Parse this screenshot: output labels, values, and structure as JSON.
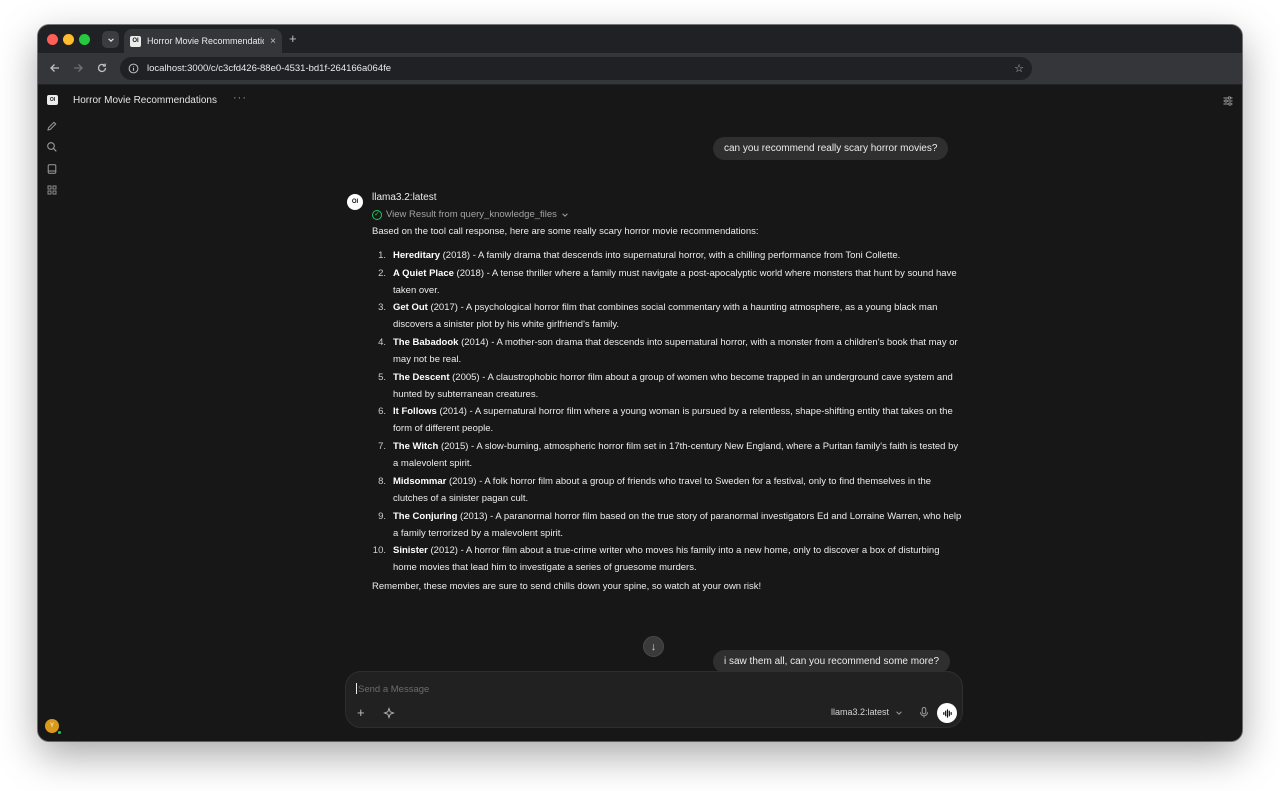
{
  "browser": {
    "tab_title": "Horror Movie Recommendatio",
    "tab_favicon": "OI",
    "url": "localhost:3000/c/c3cfd426-88e0-4531-bd1f-264166a064fe",
    "new_tab": "+",
    "close": "×"
  },
  "sidebar": {
    "logo": "OI",
    "icons": [
      "new-chat-icon",
      "search-icon",
      "workspace-icon",
      "apps-icon"
    ],
    "avatar_initial": "Y"
  },
  "header": {
    "title": "Horror Movie Recommendations",
    "menu": "···"
  },
  "messages": {
    "user_1": "can you recommend really scary horror movies?",
    "assistant": {
      "logo": "OI",
      "model": "llama3.2:latest",
      "tool_result": "View Result from query_knowledge_files",
      "intro": "Based on the tool call response, here are some really scary horror movie recommendations:",
      "items": [
        {
          "n": "1.",
          "title": "Hereditary",
          "desc": " (2018) - A family drama that descends into supernatural horror, with a chilling performance from Toni Collette."
        },
        {
          "n": "2.",
          "title": "A Quiet Place",
          "desc": " (2018) - A tense thriller where a family must navigate a post-apocalyptic world where monsters that hunt by sound have taken over."
        },
        {
          "n": "3.",
          "title": "Get Out",
          "desc": " (2017) - A psychological horror film that combines social commentary with a haunting atmosphere, as a young black man discovers a sinister plot by his white girlfriend's family."
        },
        {
          "n": "4.",
          "title": "The Babadook",
          "desc": " (2014) - A mother-son drama that descends into supernatural horror, with a monster from a children's book that may or may not be real."
        },
        {
          "n": "5.",
          "title": "The Descent",
          "desc": " (2005) - A claustrophobic horror film about a group of women who become trapped in an underground cave system and hunted by subterranean creatures."
        },
        {
          "n": "6.",
          "title": "It Follows",
          "desc": " (2014) - A supernatural horror film where a young woman is pursued by a relentless, shape-shifting entity that takes on the form of different people."
        },
        {
          "n": "7.",
          "title": "The Witch",
          "desc": " (2015) - A slow-burning, atmospheric horror film set in 17th-century New England, where a Puritan family's faith is tested by a malevolent spirit."
        },
        {
          "n": "8.",
          "title": "Midsommar",
          "desc": " (2019) - A folk horror film about a group of friends who travel to Sweden for a festival, only to find themselves in the clutches of a sinister pagan cult."
        },
        {
          "n": "9.",
          "title": "The Conjuring",
          "desc": " (2013) - A paranormal horror film based on the true story of paranormal investigators Ed and Lorraine Warren, who help a family terrorized by a malevolent spirit."
        },
        {
          "n": "10.",
          "title": "Sinister",
          "desc": " (2012) - A horror film about a true-crime writer who moves his family into a new home, only to discover a box of disturbing home movies that lead him to investigate a series of gruesome murders."
        }
      ],
      "outro": "Remember, these movies are sure to send chills down your spine, so watch at your own risk!"
    },
    "user_2": "i saw them all, can you recommend some more?"
  },
  "composer": {
    "placeholder": "Send a Message",
    "model": "llama3.2:latest",
    "plus": "+",
    "scroll_down": "↓"
  },
  "colors": {
    "background": "#171717",
    "bubble": "#2f2f2f",
    "success": "#22c55e",
    "avatar": "#d99a1b"
  }
}
